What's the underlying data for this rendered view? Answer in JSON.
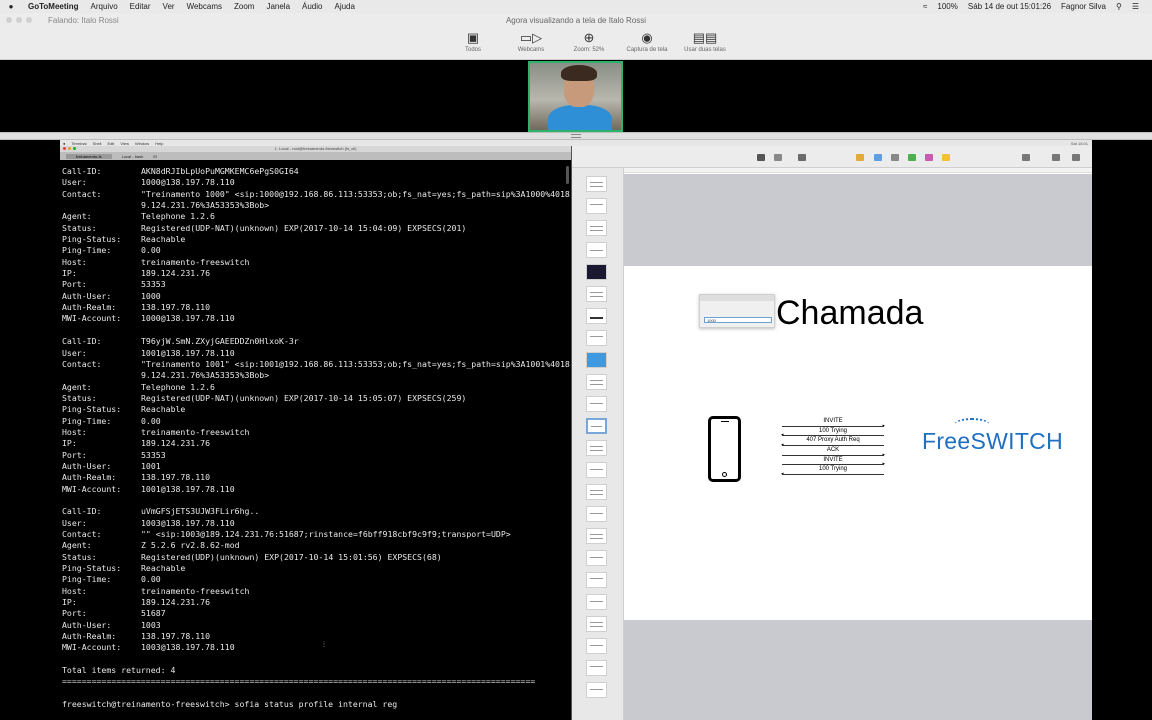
{
  "mac_menubar": {
    "app": "GoToMeeting",
    "items": [
      "Arquivo",
      "Editar",
      "Ver",
      "Webcams",
      "Zoom",
      "Janela",
      "Áudio",
      "Ajuda"
    ],
    "battery": "100%",
    "datetime": "Sáb 14 de out  15:01:26",
    "user": "Fagnor Silva"
  },
  "gtm": {
    "speaking": "Falando: Italo Rossi",
    "viewing": "Agora visualizando a tela de Italo Rossi",
    "tools": [
      {
        "label": "Todos",
        "icon": "gallery-icon"
      },
      {
        "label": "Webcams",
        "icon": "webcam-icon"
      },
      {
        "label": "Zoom: 52%",
        "icon": "zoom-icon"
      },
      {
        "label": "Captura de tela",
        "icon": "camera-icon"
      },
      {
        "label": "Usar duas telas",
        "icon": "two-screens-icon"
      }
    ]
  },
  "inner_menubar": {
    "items": [
      "Terminal",
      "Shell",
      "Edit",
      "View",
      "Window",
      "Help"
    ],
    "right": "Sat 15:01"
  },
  "terminal": {
    "title": "1. Local - root@treinamento-freeswitch (fs_cli)",
    "tabs": [
      "treinamento-fs",
      "Local - bash",
      "El"
    ],
    "blocks": [
      [
        [
          "Call-ID:",
          "AKN8dRJIbLpUoPuMGMKEMC6ePgS0GI64"
        ],
        [
          "User:",
          "1000@138.197.78.110"
        ],
        [
          "Contact:",
          "\"Treinamento 1000\" <sip:1000@192.168.86.113:53353;ob;fs_nat=yes;fs_path=sip%3A1000%4018"
        ],
        [
          "",
          "9.124.231.76%3A53353%3Bob>"
        ],
        [
          "Agent:",
          "Telephone 1.2.6"
        ],
        [
          "Status:",
          "Registered(UDP-NAT)(unknown) EXP(2017-10-14 15:04:09) EXPSECS(201)"
        ],
        [
          "Ping-Status:",
          "Reachable"
        ],
        [
          "Ping-Time:",
          "0.00"
        ],
        [
          "Host:",
          "treinamento-freeswitch"
        ],
        [
          "IP:",
          "189.124.231.76"
        ],
        [
          "Port:",
          "53353"
        ],
        [
          "Auth-User:",
          "1000"
        ],
        [
          "Auth-Realm:",
          "138.197.78.110"
        ],
        [
          "MWI-Account:",
          "1000@138.197.78.110"
        ]
      ],
      [
        [
          "Call-ID:",
          "T96yjW.SmN.ZXyjGAEEDDZn0HlxoK-3r"
        ],
        [
          "User:",
          "1001@138.197.78.110"
        ],
        [
          "Contact:",
          "\"Treinamento 1001\" <sip:1001@192.168.86.113:53353;ob;fs_nat=yes;fs_path=sip%3A1001%4018"
        ],
        [
          "",
          "9.124.231.76%3A53353%3Bob>"
        ],
        [
          "Agent:",
          "Telephone 1.2.6"
        ],
        [
          "Status:",
          "Registered(UDP-NAT)(unknown) EXP(2017-10-14 15:05:07) EXPSECS(259)"
        ],
        [
          "Ping-Status:",
          "Reachable"
        ],
        [
          "Ping-Time:",
          "0.00"
        ],
        [
          "Host:",
          "treinamento-freeswitch"
        ],
        [
          "IP:",
          "189.124.231.76"
        ],
        [
          "Port:",
          "53353"
        ],
        [
          "Auth-User:",
          "1001"
        ],
        [
          "Auth-Realm:",
          "138.197.78.110"
        ],
        [
          "MWI-Account:",
          "1001@138.197.78.110"
        ]
      ],
      [
        [
          "Call-ID:",
          "uVmGFSjETS3UJW3FLir6hg.."
        ],
        [
          "User:",
          "1003@138.197.78.110"
        ],
        [
          "Contact:",
          "\"\" <sip:1003@189.124.231.76:51687;rinstance=f6bff918cbf9c9f9;transport=UDP>"
        ],
        [
          "Agent:",
          "Z 5.2.6 rv2.8.62-mod"
        ],
        [
          "Status:",
          "Registered(UDP)(unknown) EXP(2017-10-14 15:01:56) EXPSECS(68)"
        ],
        [
          "Ping-Status:",
          "Reachable"
        ],
        [
          "Ping-Time:",
          "0.00"
        ],
        [
          "Host:",
          "treinamento-freeswitch"
        ],
        [
          "IP:",
          "189.124.231.76"
        ],
        [
          "Port:",
          "51687"
        ],
        [
          "Auth-User:",
          "1003"
        ],
        [
          "Auth-Realm:",
          "138.197.78.110"
        ],
        [
          "MWI-Account:",
          "1003@138.197.78.110"
        ]
      ]
    ],
    "total": "Total items returned: 4",
    "rule": "================================================================================================",
    "prompt": "freeswitch@treinamento-freeswitch> sofia status profile internal reg"
  },
  "keynote": {
    "slide_title": "Chamada",
    "dialog_input": "1000",
    "flow": [
      {
        "label": "INVITE",
        "dir": "right"
      },
      {
        "label": "100 Trying",
        "dir": "left"
      },
      {
        "label": "407 Proxy Auth Req",
        "dir": "left"
      },
      {
        "label": "ACK",
        "dir": "right"
      },
      {
        "label": "INVITE",
        "dir": "right"
      },
      {
        "label": "100 Trying",
        "dir": "left"
      }
    ],
    "logo": "FreeSWITCH"
  },
  "colors": {
    "webcam_border": "#2fb36b",
    "logo_blue": "#1f6fc2",
    "terminal_bg": "#000000",
    "terminal_fg": "#e9e9e9"
  }
}
